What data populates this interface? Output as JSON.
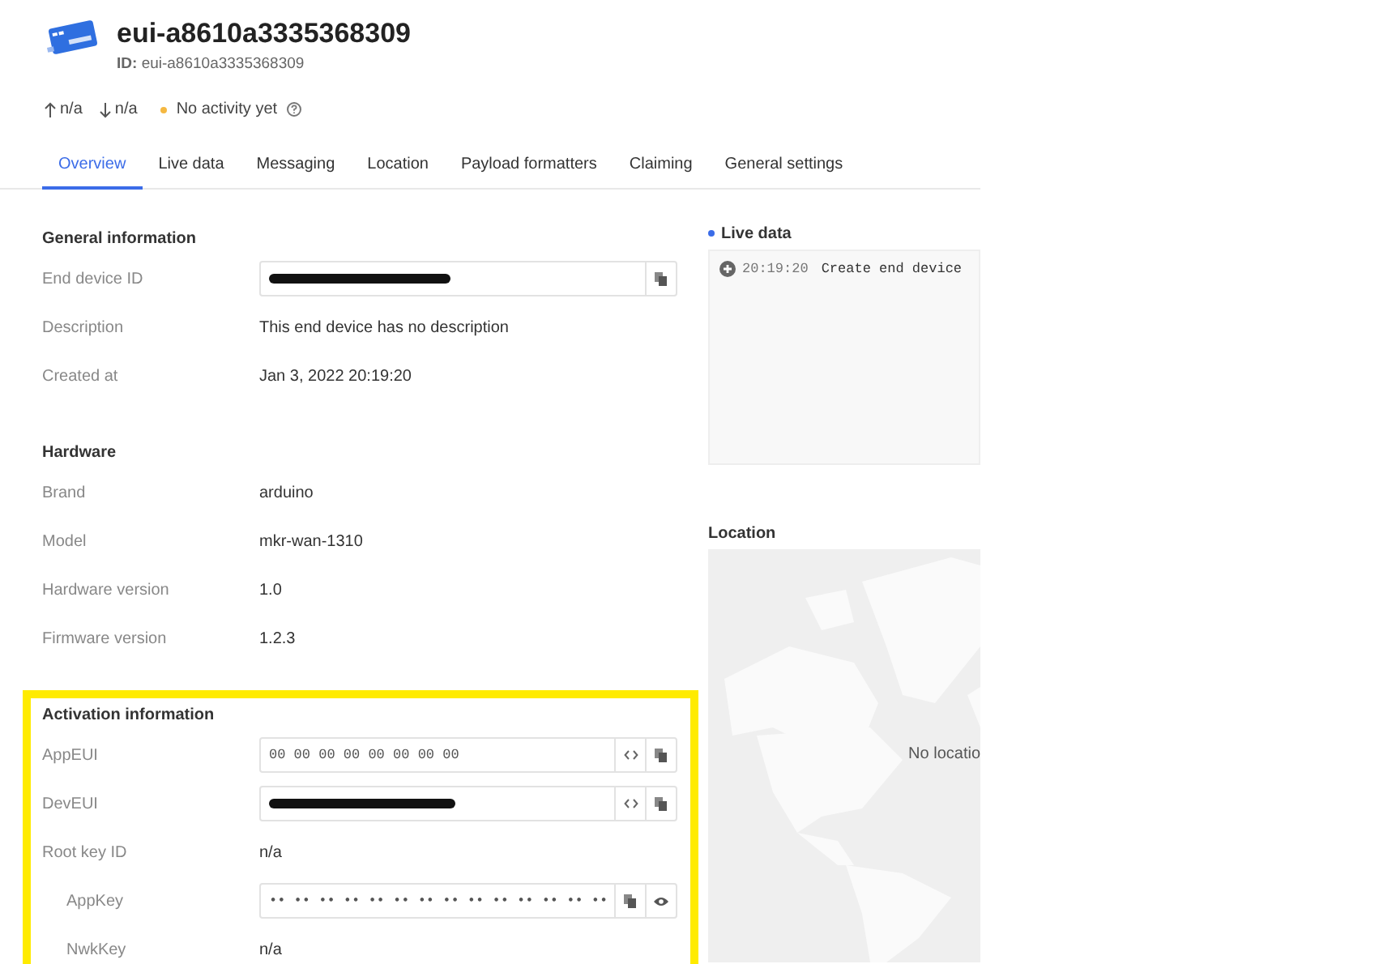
{
  "header": {
    "title": "eui-a8610a3335368309",
    "id_label": "ID:",
    "id_value": "eui-a8610a3335368309"
  },
  "status": {
    "uplink": "n/a",
    "downlink": "n/a",
    "activity": "No activity yet"
  },
  "tabs": [
    {
      "label": "Overview",
      "selected": true
    },
    {
      "label": "Live data",
      "selected": false
    },
    {
      "label": "Messaging",
      "selected": false
    },
    {
      "label": "Location",
      "selected": false
    },
    {
      "label": "Payload formatters",
      "selected": false
    },
    {
      "label": "Claiming",
      "selected": false
    },
    {
      "label": "General settings",
      "selected": false
    }
  ],
  "sections": [
    {
      "title": "General information",
      "highlighted": false,
      "rows": [
        {
          "label": "End device ID",
          "kind": "field",
          "redacted": true,
          "actions": [
            {
              "kind": "copy"
            }
          ]
        },
        {
          "label": "Description",
          "kind": "text",
          "value": "This end device has no description"
        },
        {
          "label": "Created at",
          "kind": "text",
          "value": "Jan 3, 2022 20:19:20"
        }
      ]
    },
    {
      "title": "Hardware",
      "highlighted": false,
      "rows": [
        {
          "label": "Brand",
          "kind": "text",
          "value": "arduino"
        },
        {
          "label": "Model",
          "kind": "text",
          "value": "mkr-wan-1310"
        },
        {
          "label": "Hardware version",
          "kind": "text",
          "value": "1.0"
        },
        {
          "label": "Firmware version",
          "kind": "text",
          "value": "1.2.3"
        }
      ]
    },
    {
      "title": "Activation information",
      "highlighted": true,
      "rows": [
        {
          "label": "AppEUI",
          "kind": "field",
          "value": "00 00 00 00 00 00 00 00",
          "actions": [
            {
              "kind": "format"
            },
            {
              "kind": "copy"
            }
          ]
        },
        {
          "label": "DevEUI",
          "kind": "field",
          "redacted": true,
          "actions": [
            {
              "kind": "format"
            },
            {
              "kind": "copy"
            }
          ]
        },
        {
          "label": "Root key ID",
          "kind": "text",
          "value": "n/a"
        },
        {
          "label": "AppKey",
          "kind": "field",
          "indented": true,
          "value": "•• •• •• •• •• •• •• •• •• •• •• •• •• ••",
          "actions": [
            {
              "kind": "copy"
            },
            {
              "kind": "show"
            }
          ]
        },
        {
          "label": "NwkKey",
          "kind": "text",
          "indented": true,
          "value": "n/a"
        }
      ]
    }
  ],
  "live_data": {
    "title": "Live data",
    "events": [
      {
        "time": "20:19:20",
        "message": "Create end device"
      }
    ]
  },
  "location": {
    "title": "Location",
    "message": "No locatio"
  }
}
